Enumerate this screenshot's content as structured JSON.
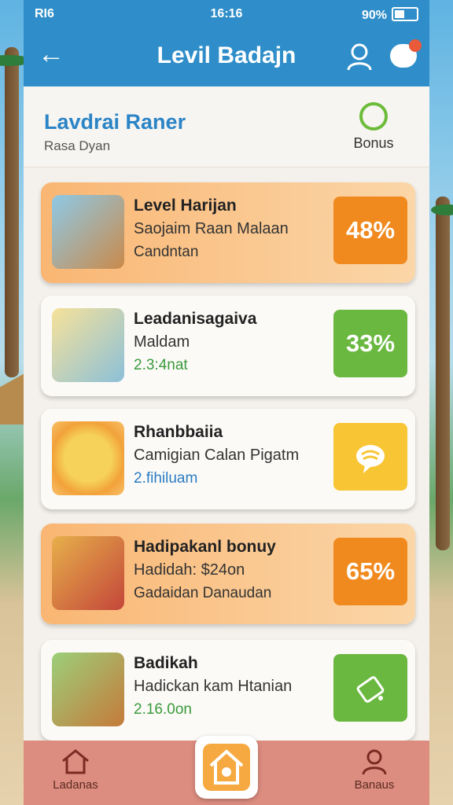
{
  "status": {
    "signal": "RI6",
    "time": "16:16",
    "battery": "90%"
  },
  "appbar": {
    "title": "Levil Badajn"
  },
  "header": {
    "title": "Lavdrai Raner",
    "subtitle": "Rasa Dyan",
    "bonus_label": "Bonus"
  },
  "cards": [
    {
      "title": "Level Harijan",
      "line2": "Saojaim Raan Malaan",
      "line3": "Candntan",
      "badge": "48%",
      "style": "orange",
      "badge_color": "#f08a1f"
    },
    {
      "title": "Leadanisagaiva",
      "line2": "Maldam",
      "line3": "2.3:4nat",
      "badge": "33%",
      "style": "white",
      "badge_color": "#6ab840"
    },
    {
      "title": "Rhanbbaiia",
      "line2": "Camigian Calan Pigatm",
      "line3": "2.fihiluam",
      "badge": "",
      "style": "white",
      "badge_color": "#f8c534"
    },
    {
      "title": "Hadipakanl bonuy",
      "line2": "Hadidah: $24on",
      "line3": "Gadaidan Danaudan",
      "badge": "65%",
      "style": "orange",
      "badge_color": "#f08a1f"
    },
    {
      "title": "Badikah",
      "line2": "Hadickan kam Htanian",
      "line3": "2.16.0on",
      "badge": "",
      "style": "white",
      "badge_color": "#6ab840"
    }
  ],
  "bottom_nav": {
    "left_label": "Ladanas",
    "right_label": "Banaus"
  }
}
